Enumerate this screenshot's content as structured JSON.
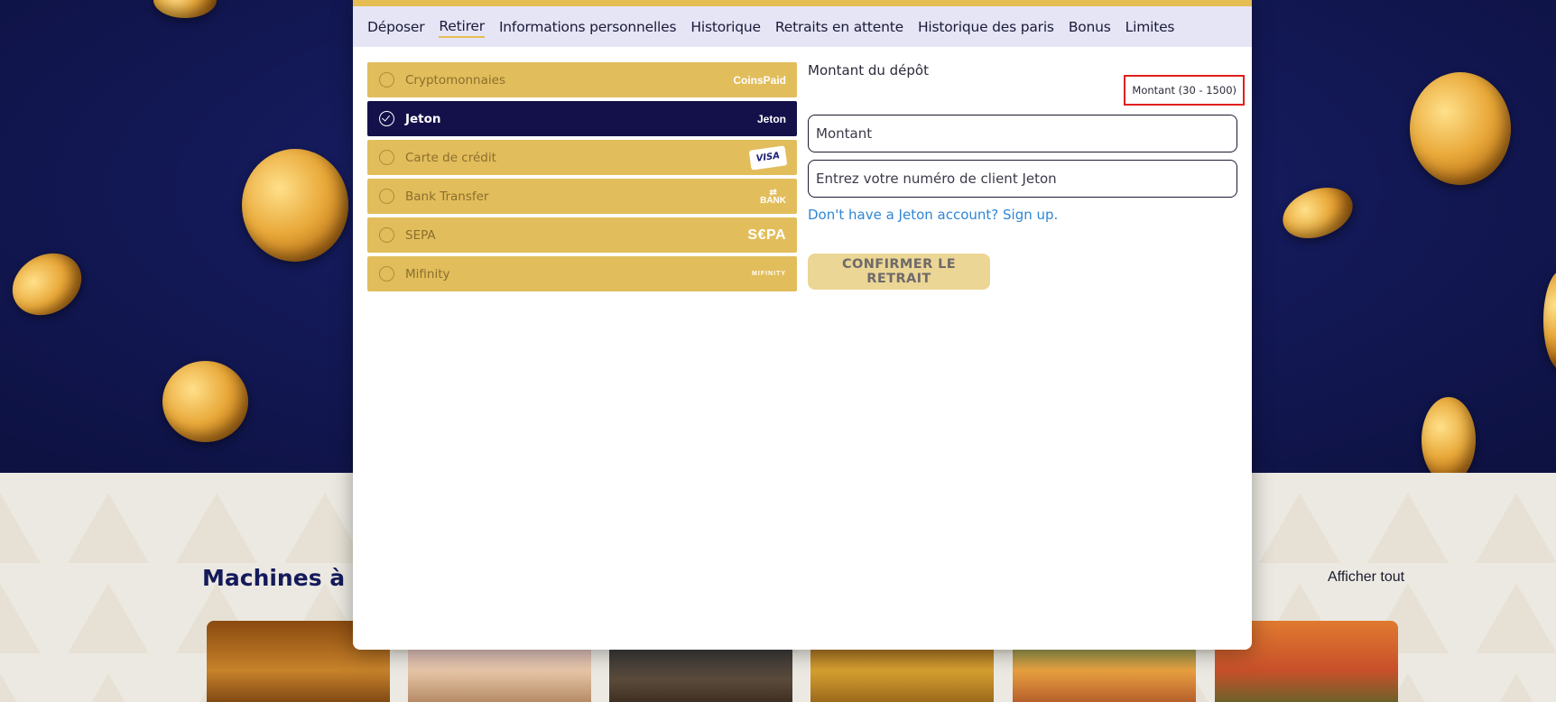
{
  "tabs": [
    {
      "label": "Déposer"
    },
    {
      "label": "Retirer"
    },
    {
      "label": "Informations personnelles"
    },
    {
      "label": "Historique"
    },
    {
      "label": "Retraits en attente"
    },
    {
      "label": "Historique des paris"
    },
    {
      "label": "Bonus"
    },
    {
      "label": "Limites"
    }
  ],
  "active_tab": "Retirer",
  "methods": [
    {
      "label": "Cryptomonnaies",
      "logo": "CoinsPaid",
      "selected": false
    },
    {
      "label": "Jeton",
      "logo": "Jeton",
      "selected": true
    },
    {
      "label": "Carte de crédit",
      "logo": "VISA",
      "selected": false
    },
    {
      "label": "Bank Transfer",
      "logo": "BANK",
      "selected": false
    },
    {
      "label": "SEPA",
      "logo": "S€PA",
      "selected": false
    },
    {
      "label": "Mifinity",
      "logo": "MIFINITY",
      "selected": false
    }
  ],
  "form": {
    "title": "Montant du dépôt",
    "range": "Montant (30 - 1500)",
    "amount_placeholder": "Montant",
    "client_placeholder": "Entrez votre numéro de client Jeton",
    "signup_link": "Don't have a Jeton account? Sign up.",
    "confirm_label": "CONFIRMER LE RETRAIT"
  },
  "background": {
    "section_title": "Machines à S",
    "view_all": "Afficher tout"
  },
  "colors": {
    "accent": "#e6bd52",
    "selected": "#14114a",
    "link": "#2f86d6",
    "highlight": "#e0201f"
  }
}
